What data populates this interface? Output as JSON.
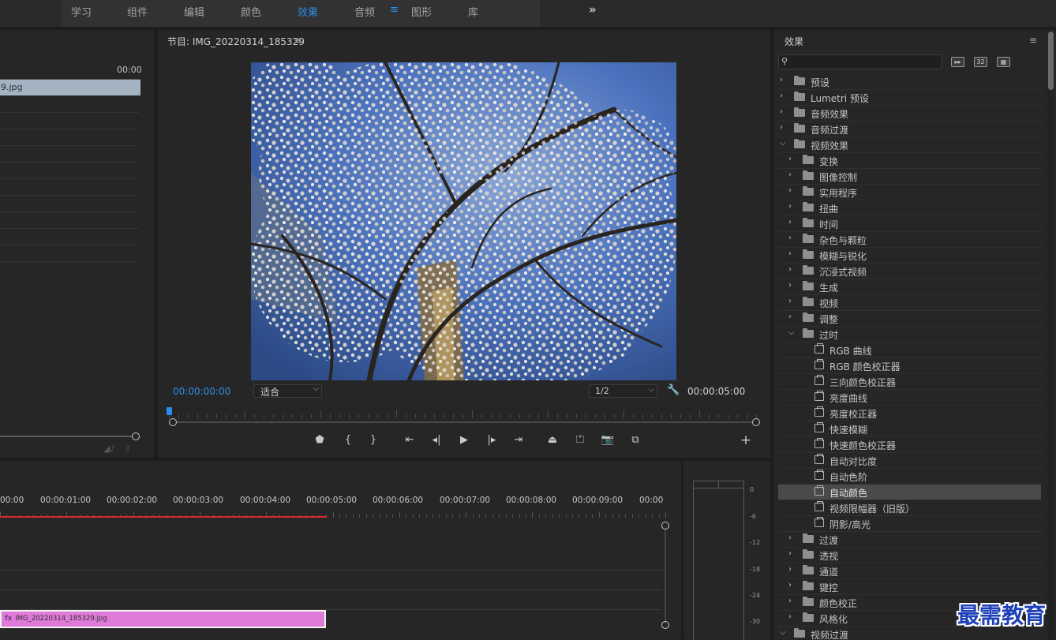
{
  "topbar": {
    "tabs": [
      {
        "label": "学习"
      },
      {
        "label": "组件"
      },
      {
        "label": "编辑"
      },
      {
        "label": "颜色"
      },
      {
        "label": "效果",
        "active": true
      },
      {
        "label": "音频"
      },
      {
        "label": "图形"
      },
      {
        "label": "库"
      }
    ],
    "menu_glyph": "≡",
    "overflow_glyph": "»"
  },
  "source": {
    "time_end": "00:00",
    "clip_label": "9.jpg"
  },
  "program": {
    "title": "节目: IMG_20220314_185329",
    "current_time": "00:00:00:00",
    "fit_label": "适合",
    "resolution": "1/2",
    "duration": "00:00:05:00",
    "playhead_fraction": 0.0
  },
  "timeline": {
    "timecodes": [
      "00:00",
      "00:00:01:00",
      "00:00:02:00",
      "00:00:03:00",
      "00:00:04:00",
      "00:00:05:00",
      "00:00:06:00",
      "00:00:07:00",
      "00:00:08:00",
      "00:00:09:00",
      "00:00"
    ],
    "clip_label": "IMG_20220314_185329.jpg",
    "clip_fx": "fx"
  },
  "meter": {
    "labels": [
      "0",
      "-6",
      "-12",
      "-18",
      "-24",
      "-30"
    ]
  },
  "effects": {
    "title": "效果",
    "search_placeholder": "",
    "icons": [
      "32"
    ],
    "tree": [
      {
        "label": "预设",
        "level": 0,
        "type": "preset",
        "expanded": false
      },
      {
        "label": "Lumetri 预设",
        "level": 0,
        "type": "preset",
        "expanded": false
      },
      {
        "label": "音频效果",
        "level": 0,
        "type": "folder",
        "expanded": false
      },
      {
        "label": "音频过渡",
        "level": 0,
        "type": "folder",
        "expanded": false
      },
      {
        "label": "视频效果",
        "level": 0,
        "type": "folder",
        "expanded": true
      },
      {
        "label": "变换",
        "level": 1,
        "type": "folder",
        "expanded": false
      },
      {
        "label": "图像控制",
        "level": 1,
        "type": "folder",
        "expanded": false
      },
      {
        "label": "实用程序",
        "level": 1,
        "type": "folder",
        "expanded": false
      },
      {
        "label": "扭曲",
        "level": 1,
        "type": "folder",
        "expanded": false
      },
      {
        "label": "时间",
        "level": 1,
        "type": "folder",
        "expanded": false
      },
      {
        "label": "杂色与颗粒",
        "level": 1,
        "type": "folder",
        "expanded": false
      },
      {
        "label": "模糊与锐化",
        "level": 1,
        "type": "folder",
        "expanded": false
      },
      {
        "label": "沉浸式视频",
        "level": 1,
        "type": "folder",
        "expanded": false
      },
      {
        "label": "生成",
        "level": 1,
        "type": "folder",
        "expanded": false
      },
      {
        "label": "视频",
        "level": 1,
        "type": "folder",
        "expanded": false
      },
      {
        "label": "调整",
        "level": 1,
        "type": "folder",
        "expanded": false
      },
      {
        "label": "过时",
        "level": 1,
        "type": "folder",
        "expanded": true
      },
      {
        "label": "RGB 曲线",
        "level": 2,
        "type": "effect"
      },
      {
        "label": "RGB 颜色校正器",
        "level": 2,
        "type": "effect"
      },
      {
        "label": "三向颜色校正器",
        "level": 2,
        "type": "effect"
      },
      {
        "label": "亮度曲线",
        "level": 2,
        "type": "effect"
      },
      {
        "label": "亮度校正器",
        "level": 2,
        "type": "effect"
      },
      {
        "label": "快速模糊",
        "level": 2,
        "type": "effect"
      },
      {
        "label": "快速颜色校正器",
        "level": 2,
        "type": "effect"
      },
      {
        "label": "自动对比度",
        "level": 2,
        "type": "effect"
      },
      {
        "label": "自动色阶",
        "level": 2,
        "type": "effect"
      },
      {
        "label": "自动颜色",
        "level": 2,
        "type": "effect",
        "selected": true
      },
      {
        "label": "视频限幅器（旧版）",
        "level": 2,
        "type": "effect"
      },
      {
        "label": "阴影/高光",
        "level": 2,
        "type": "effect"
      },
      {
        "label": "过渡",
        "level": 1,
        "type": "folder",
        "expanded": false
      },
      {
        "label": "透视",
        "level": 1,
        "type": "folder",
        "expanded": false
      },
      {
        "label": "通道",
        "level": 1,
        "type": "folder",
        "expanded": false
      },
      {
        "label": "键控",
        "level": 1,
        "type": "folder",
        "expanded": false
      },
      {
        "label": "颜色校正",
        "level": 1,
        "type": "folder",
        "expanded": false
      },
      {
        "label": "风格化",
        "level": 1,
        "type": "folder",
        "expanded": false
      },
      {
        "label": "视频过渡",
        "level": 0,
        "type": "folder",
        "expanded": true
      }
    ]
  },
  "watermark": "最需教育",
  "colors": {
    "accent": "#2d8ceb",
    "clip_pink": "#e07ad8",
    "clip_blue": "#a3b3c1",
    "workarea": "#d52b2b"
  }
}
